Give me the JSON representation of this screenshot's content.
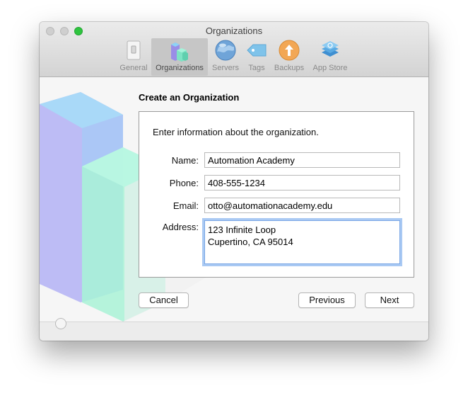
{
  "window": {
    "title": "Organizations"
  },
  "toolbar": {
    "items": [
      {
        "label": "General"
      },
      {
        "label": "Organizations"
      },
      {
        "label": "Servers"
      },
      {
        "label": "Tags"
      },
      {
        "label": "Backups"
      },
      {
        "label": "App Store"
      }
    ]
  },
  "sheet": {
    "title": "Create an Organization",
    "intro": "Enter information about the organization.",
    "fields": {
      "name": {
        "label": "Name:",
        "value": "Automation Academy"
      },
      "phone": {
        "label": "Phone:",
        "value": "408-555-1234"
      },
      "email": {
        "label": "Email:",
        "value": "otto@automationacademy.edu"
      },
      "address": {
        "label": "Address:",
        "line1": "123 Infinite Loop",
        "line2": "Cupertino, CA 95014"
      }
    },
    "buttons": {
      "cancel": "Cancel",
      "previous": "Previous",
      "next": "Next"
    }
  },
  "colors": {
    "accent": "#7aa7e6",
    "zoom_button": "#2fc43f"
  },
  "icons": [
    "general-icon",
    "organizations-icon",
    "servers-icon",
    "tags-icon",
    "backups-icon",
    "app-store-icon",
    "help-icon"
  ]
}
